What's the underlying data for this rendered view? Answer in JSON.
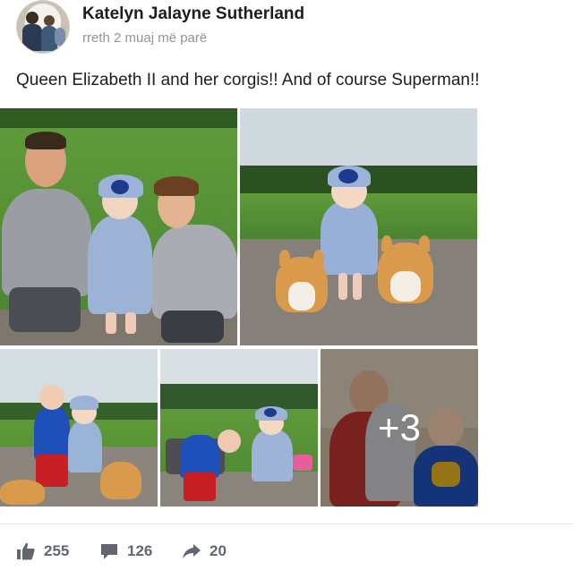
{
  "post": {
    "author": "Katelyn Jalayne Sutherland",
    "timestamp": "rreth 2 muaj më parë",
    "text": "Queen Elizabeth II and her corgis!! And of course Superman!!",
    "more_photos_label": "+3"
  },
  "reactions": {
    "likes": "255",
    "comments": "126",
    "shares": "20"
  },
  "icons": {
    "like": "thumbs-up-icon",
    "comment": "speech-bubble-icon",
    "share": "share-arrow-icon"
  },
  "colors": {
    "text_primary": "#1c1e21",
    "text_secondary": "#90949c",
    "action_gray": "#606770"
  }
}
